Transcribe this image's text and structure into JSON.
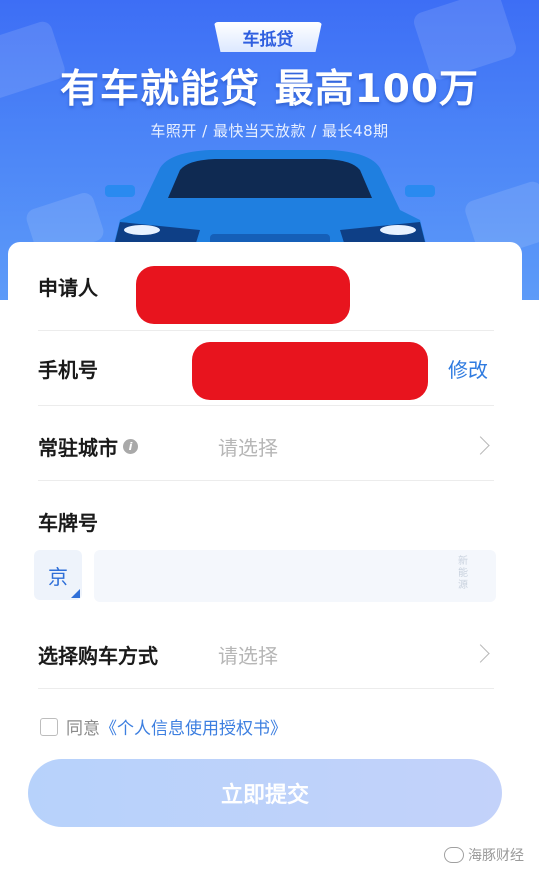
{
  "banner": {
    "tag": "车抵贷",
    "headline": "有车就能贷 最高100万",
    "subline": "车照开 / 最快当天放款 / 最长48期"
  },
  "form": {
    "applicant_label": "申请人",
    "phone_label": "手机号",
    "phone_edit": "修改",
    "city_label": "常驻城市",
    "city_placeholder": "请选择",
    "plate_label": "车牌号",
    "plate_prefix": "京",
    "plate_new_energy": "新能源",
    "purchase_label": "选择购车方式",
    "purchase_placeholder": "请选择",
    "agree_text": "同意",
    "agree_link": "《个人信息使用授权书》",
    "submit_label": "立即提交"
  },
  "watermark": "海豚财经",
  "colors": {
    "banner_blue": "#4b84f7",
    "link_blue": "#2f7be0",
    "redaction": "#e8141e",
    "submit_disabled": "#bcd2fa"
  }
}
